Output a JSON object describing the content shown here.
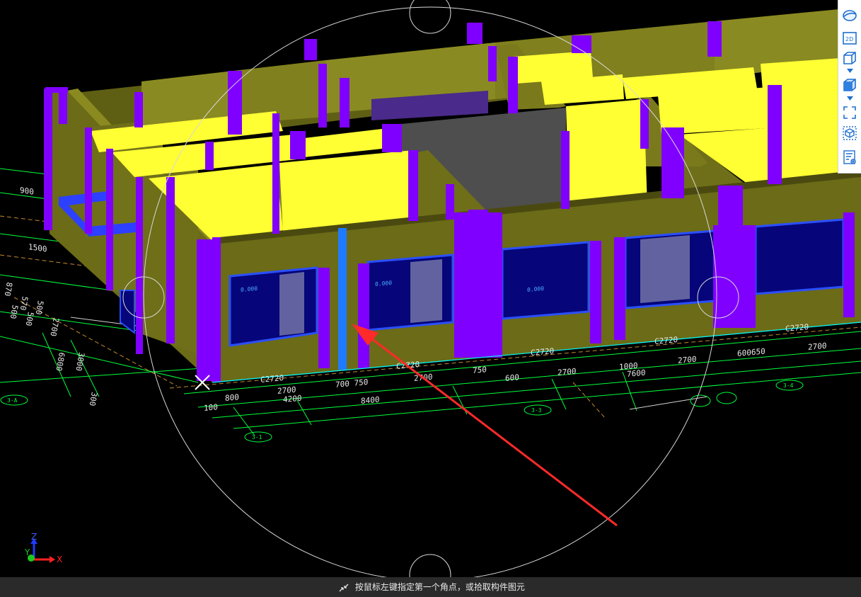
{
  "toolbar": {
    "buttons": [
      {
        "icon": "dynamic-observe-icon"
      },
      {
        "icon": "view-2d-icon",
        "label": "2D"
      },
      {
        "icon": "view-3d-box-icon"
      },
      {
        "icon": "view-cube-icon"
      },
      {
        "icon": "full-screen-icon"
      },
      {
        "icon": "component-view-icon"
      },
      {
        "icon": "property-list-icon"
      }
    ]
  },
  "axes": {
    "z": "Z",
    "y": "Y",
    "x": "X"
  },
  "status": {
    "message": "按鼠标左键指定第一个角点，或拾取构件图元"
  },
  "drawing": {
    "window_labels": [
      "C2720",
      "C2720",
      "C2720",
      "C2720",
      "C2720"
    ],
    "front_dims": [
      "800",
      "2700",
      "4200",
      "700 750",
      "8400",
      "2700",
      "750",
      "600",
      "2700",
      "1000",
      "7600",
      "2700",
      "600650",
      "2700",
      "100"
    ],
    "grid_bubbles": [
      "3-A",
      "3-1",
      "3-3",
      "3-4"
    ],
    "left_dims": [
      "900",
      "1500"
    ],
    "rotated_left": [
      "870",
      "570",
      "500",
      "2700",
      "6800",
      "3000",
      "500",
      "500",
      "300"
    ],
    "room_text": [
      "0.000",
      "0.000",
      "0.000"
    ]
  },
  "colors": {
    "background": "#000000",
    "wall": "#6b6b18",
    "wall_top": "#ffff33",
    "column": "#8000ff",
    "window_glass": "#06067a",
    "window_frame": "#2a4fff",
    "beam": "#2d3fff",
    "selected_column": "#1e7bff",
    "floor_gray": "#4e4e4e",
    "grid_lines": "#00ff3c",
    "annotation_arrow": "#ff2a2a",
    "status_bar": "#2a2a2a"
  }
}
